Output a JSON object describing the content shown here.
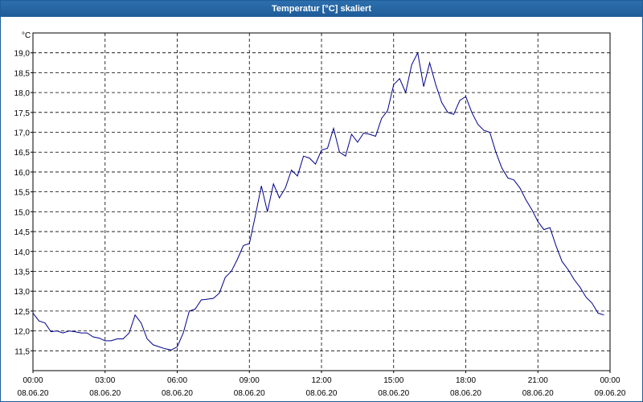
{
  "window": {
    "title": "Temperatur [°C] skaliert"
  },
  "colors": {
    "line": "#00008b",
    "grid": "#000000",
    "title_bar": "#1e5c98"
  },
  "chart_data": {
    "type": "line",
    "title": "Temperatur [°C] skaliert",
    "y_unit": "°C",
    "ylim": [
      11.0,
      19.5
    ],
    "y_ticks": [
      "11,5",
      "12,0",
      "12,5",
      "13,0",
      "13,5",
      "14,0",
      "14,5",
      "15,0",
      "15,5",
      "16,0",
      "16,5",
      "17,0",
      "17,5",
      "18,0",
      "18,5",
      "19,0"
    ],
    "x_range": [
      "08.06.20 00:00",
      "09.06.20 00:00"
    ],
    "x_ticks": [
      {
        "time": "00:00",
        "date": "08.06.20"
      },
      {
        "time": "03:00",
        "date": "08.06.20"
      },
      {
        "time": "06:00",
        "date": "08.06.20"
      },
      {
        "time": "09:00",
        "date": "08.06.20"
      },
      {
        "time": "12:00",
        "date": "08.06.20"
      },
      {
        "time": "15:00",
        "date": "08.06.20"
      },
      {
        "time": "18:00",
        "date": "08.06.20"
      },
      {
        "time": "21:00",
        "date": "08.06.20"
      },
      {
        "time": "00:00",
        "date": "09.06.20"
      }
    ],
    "grid": true,
    "series": [
      {
        "x": [
          "08.06.20 00:00",
          "08.06.20 00:15",
          "08.06.20 00:30",
          "08.06.20 00:45",
          "08.06.20 01:00",
          "08.06.20 01:15",
          "08.06.20 01:30",
          "08.06.20 01:45",
          "08.06.20 02:00",
          "08.06.20 02:15",
          "08.06.20 02:30",
          "08.06.20 02:45",
          "08.06.20 03:00",
          "08.06.20 03:15",
          "08.06.20 03:30",
          "08.06.20 03:45",
          "08.06.20 04:00",
          "08.06.20 04:15",
          "08.06.20 04:30",
          "08.06.20 04:45",
          "08.06.20 05:00",
          "08.06.20 05:15",
          "08.06.20 05:30",
          "08.06.20 05:45",
          "08.06.20 06:00",
          "08.06.20 06:15",
          "08.06.20 06:30",
          "08.06.20 06:45",
          "08.06.20 07:00",
          "08.06.20 07:15",
          "08.06.20 07:30",
          "08.06.20 07:45",
          "08.06.20 08:00",
          "08.06.20 08:15",
          "08.06.20 08:30",
          "08.06.20 08:45",
          "08.06.20 09:00",
          "08.06.20 09:15",
          "08.06.20 09:30",
          "08.06.20 09:45",
          "08.06.20 10:00",
          "08.06.20 10:15",
          "08.06.20 10:30",
          "08.06.20 10:45",
          "08.06.20 11:00",
          "08.06.20 11:15",
          "08.06.20 11:30",
          "08.06.20 11:45",
          "08.06.20 12:00",
          "08.06.20 12:15",
          "08.06.20 12:30",
          "08.06.20 12:45",
          "08.06.20 13:00",
          "08.06.20 13:15",
          "08.06.20 13:30",
          "08.06.20 13:45",
          "08.06.20 14:00",
          "08.06.20 14:15",
          "08.06.20 14:30",
          "08.06.20 14:45",
          "08.06.20 15:00",
          "08.06.20 15:15",
          "08.06.20 15:30",
          "08.06.20 15:45",
          "08.06.20 16:00",
          "08.06.20 16:15",
          "08.06.20 16:30",
          "08.06.20 16:45",
          "08.06.20 17:00",
          "08.06.20 17:15",
          "08.06.20 17:30",
          "08.06.20 17:45",
          "08.06.20 18:00",
          "08.06.20 18:15",
          "08.06.20 18:30",
          "08.06.20 18:45",
          "08.06.20 19:00",
          "08.06.20 19:15",
          "08.06.20 19:30",
          "08.06.20 19:45",
          "08.06.20 20:00",
          "08.06.20 20:15",
          "08.06.20 20:30",
          "08.06.20 20:45",
          "08.06.20 21:00",
          "08.06.20 21:15",
          "08.06.20 21:30",
          "08.06.20 21:45",
          "08.06.20 22:00",
          "08.06.20 22:15",
          "08.06.20 22:30",
          "08.06.20 22:45",
          "08.06.20 23:00",
          "08.06.20 23:15",
          "08.06.20 23:30",
          "08.06.20 23:45"
        ],
        "y": [
          12.45,
          12.25,
          12.2,
          11.98,
          12.0,
          11.95,
          12.0,
          11.98,
          11.95,
          11.95,
          11.85,
          11.82,
          11.75,
          11.75,
          11.8,
          11.8,
          11.95,
          12.4,
          12.2,
          11.8,
          11.65,
          11.6,
          11.55,
          11.52,
          11.6,
          11.95,
          12.5,
          12.55,
          12.78,
          12.8,
          12.82,
          12.95,
          13.35,
          13.5,
          13.8,
          14.15,
          14.2,
          14.9,
          15.65,
          15.0,
          15.7,
          15.35,
          15.6,
          16.05,
          15.9,
          16.4,
          16.35,
          16.2,
          16.55,
          16.6,
          17.1,
          16.5,
          16.4,
          16.95,
          16.75,
          16.98,
          16.95,
          16.9,
          17.35,
          17.55,
          18.2,
          18.35,
          18.0,
          18.7,
          19.0,
          18.15,
          18.75,
          18.2,
          17.75,
          17.5,
          17.45,
          17.8,
          17.9,
          17.5,
          17.2,
          17.05,
          17.0,
          16.5,
          16.1,
          15.85,
          15.8,
          15.6,
          15.3,
          15.05,
          14.75,
          14.55,
          14.6,
          14.15,
          13.75,
          13.55,
          13.3,
          13.1,
          12.85,
          12.7,
          12.45,
          12.4
        ]
      }
    ]
  }
}
